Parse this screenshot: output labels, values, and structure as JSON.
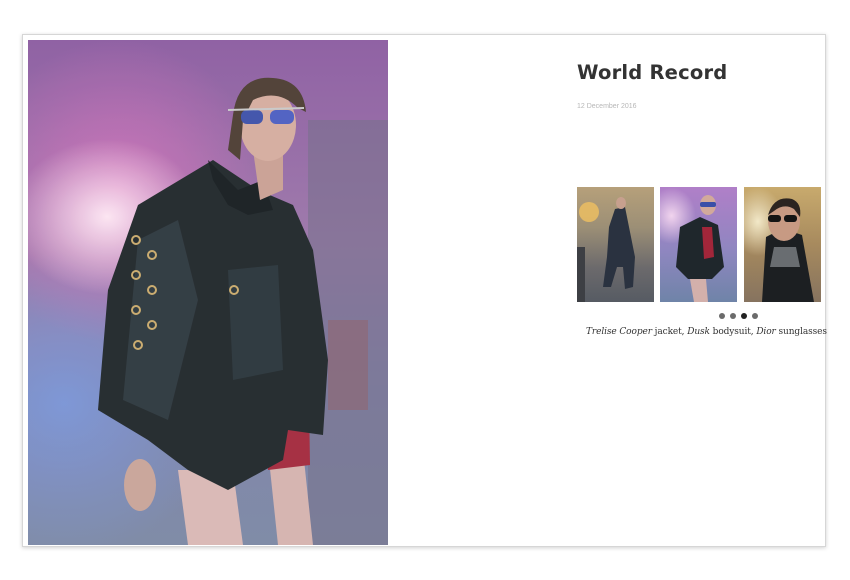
{
  "article": {
    "title": "World Record",
    "date": "12 December 2016"
  },
  "gallery": {
    "thumbnails": [
      {
        "icon": "model-in-coat-photo"
      },
      {
        "icon": "model-in-leather-jacket-photo"
      },
      {
        "icon": "model-in-sunglasses-photo"
      }
    ],
    "dots_count": 4,
    "active_dot": 3
  },
  "caption": {
    "brand_1": "Trelise Cooper",
    "item_1": " jacket, ",
    "brand_2": "Dusk",
    "item_2": " bodysuit, ",
    "brand_3": "Dior",
    "item_3": " sunglasses"
  },
  "colors": {
    "title": "#333333",
    "date": "#b7b7b7",
    "active_dot": "#222222",
    "inactive_dot": "#6b6b6b"
  }
}
